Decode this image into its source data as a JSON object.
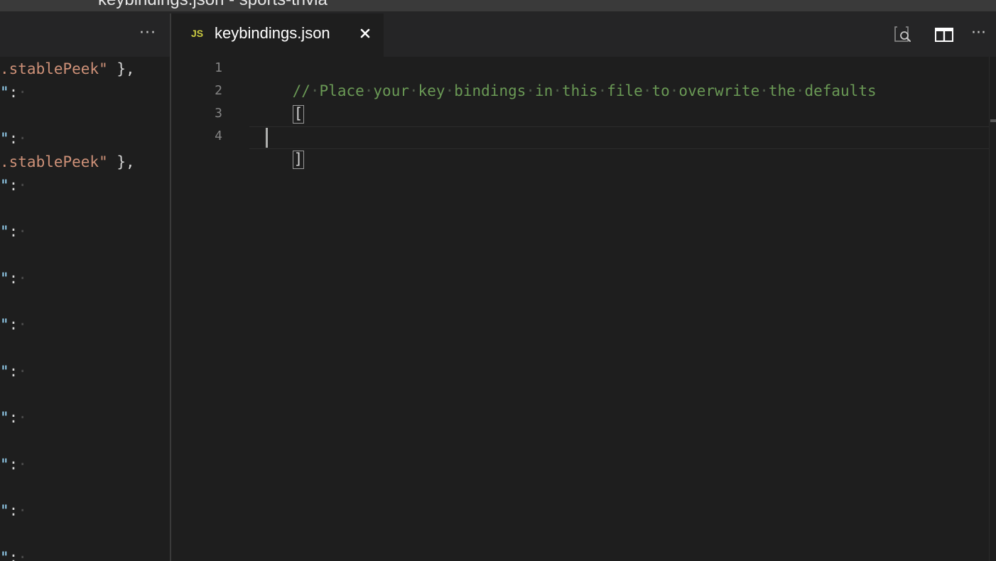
{
  "window": {
    "title": "keybindings.json - sports-trivia"
  },
  "left_pane": {
    "more_actions_label": "···",
    "lines": [
      {
        "kind": "str",
        "text": ".stablePeek\"",
        "tail": " },"
      },
      {
        "kind": "key",
        "text": "\"",
        "tail": ":"
      },
      {
        "kind": "key",
        "text": "\"",
        "tail": ":"
      },
      {
        "kind": "str",
        "text": ".stablePeek\"",
        "tail": " },"
      },
      {
        "kind": "key",
        "text": "\"",
        "tail": ":"
      },
      {
        "kind": "key",
        "text": "\"",
        "tail": ":"
      },
      {
        "kind": "key",
        "text": "\"",
        "tail": ":"
      },
      {
        "kind": "key",
        "text": "\"",
        "tail": ":"
      },
      {
        "kind": "key",
        "text": "\"",
        "tail": ":"
      },
      {
        "kind": "key",
        "text": "\"",
        "tail": ":"
      },
      {
        "kind": "key",
        "text": "\"",
        "tail": ":"
      },
      {
        "kind": "key",
        "text": "\"",
        "tail": ":"
      },
      {
        "kind": "key",
        "text": "\"",
        "tail": ":"
      }
    ]
  },
  "editor": {
    "tab": {
      "language_badge": "JS",
      "label": "keybindings.json"
    },
    "actions": {
      "open_settings_icon": "open-keyboard-shortcuts-icon",
      "split_editor_icon": "split-editor-icon",
      "more_actions_label": "···"
    },
    "line_numbers": [
      "1",
      "2",
      "3",
      "4"
    ],
    "code": {
      "line1": "// Place your key bindings in this file to overwrite the defaults",
      "line2": "[",
      "line3": "",
      "line4": "]"
    },
    "colors": {
      "comment": "#6a9955",
      "string": "#ce9178",
      "property": "#9cdcfe",
      "background": "#1e1e1e"
    }
  }
}
